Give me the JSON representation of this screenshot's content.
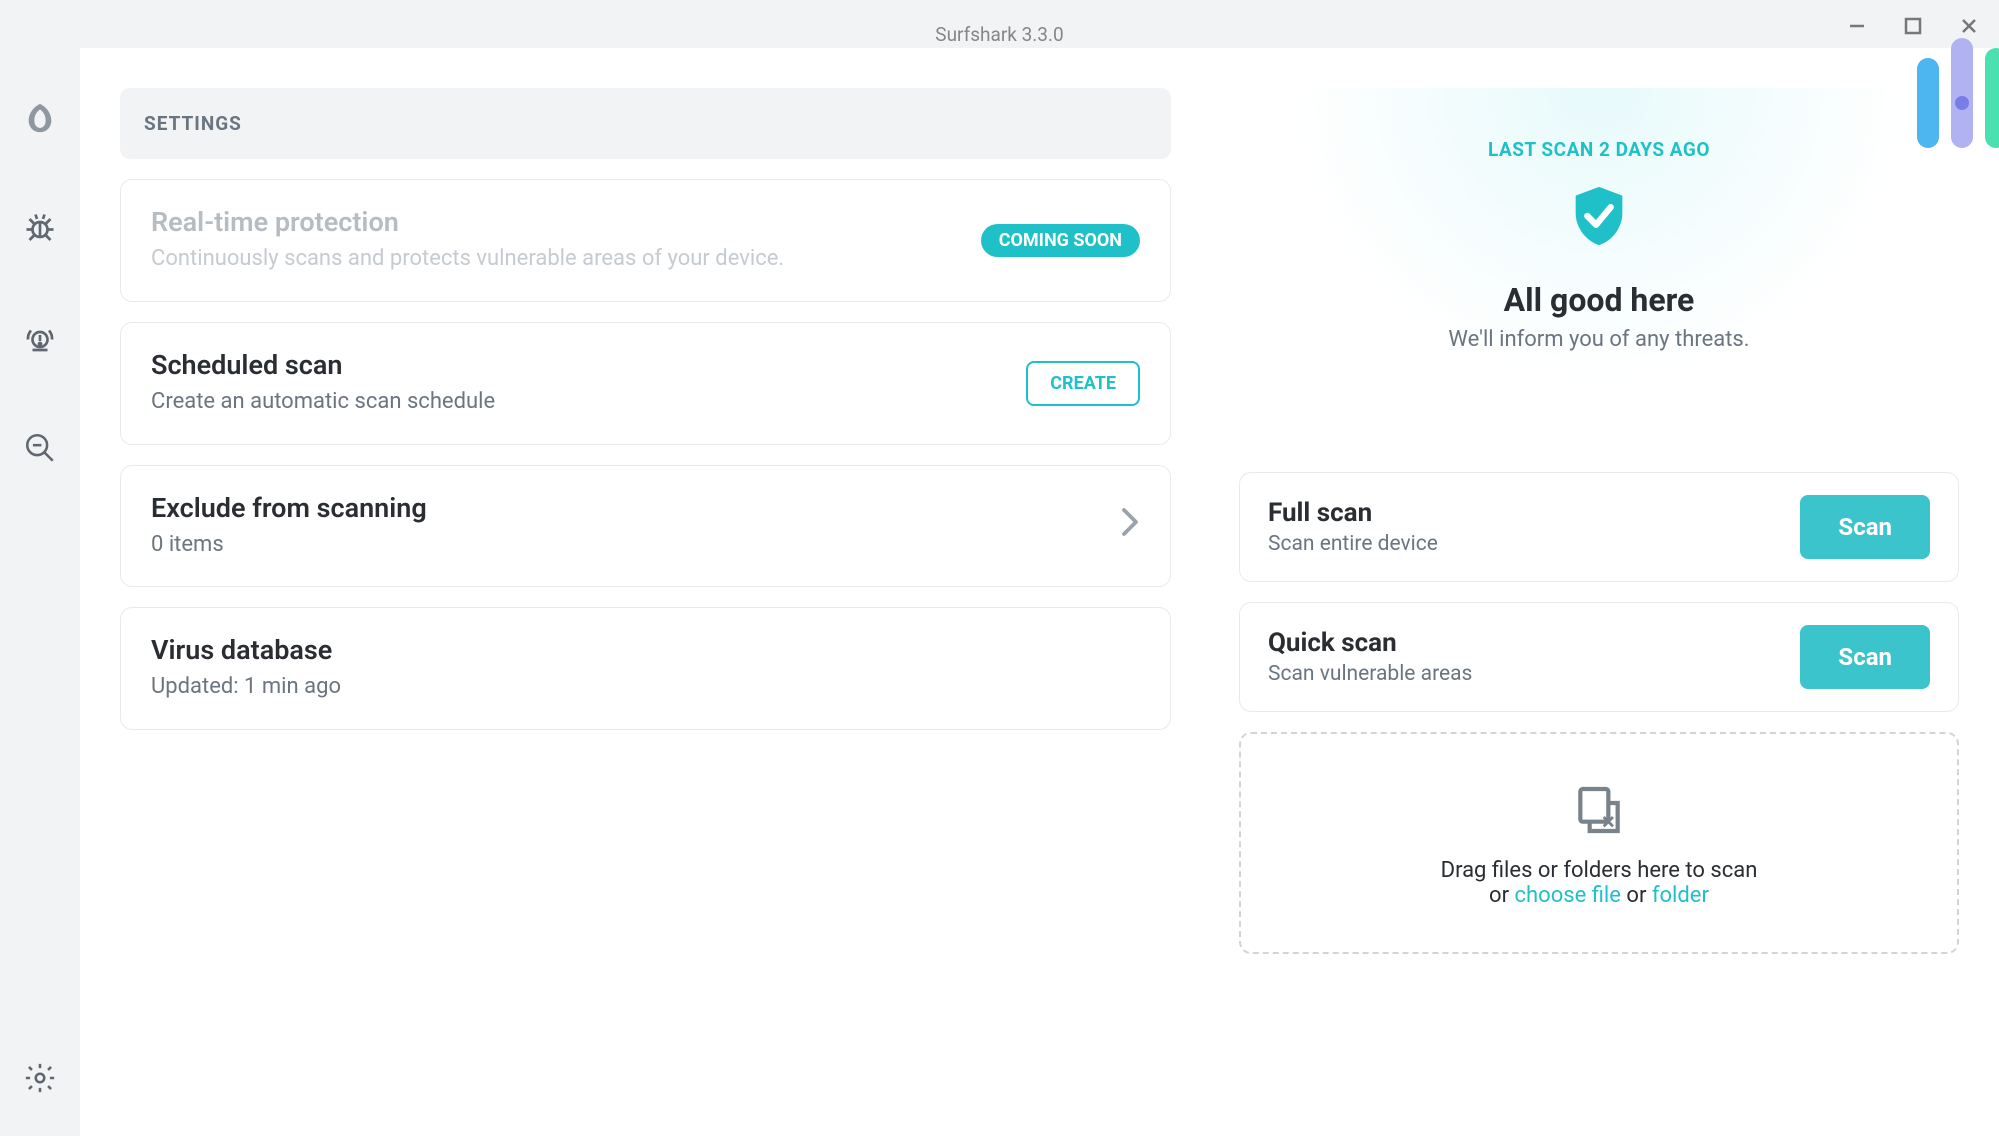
{
  "titlebar": {
    "title": "Surfshark 3.3.0"
  },
  "settings": {
    "header": "SETTINGS",
    "items": [
      {
        "title": "Real-time protection",
        "desc": "Continuously scans and protects vulnerable areas of your device.",
        "badge": "COMING SOON"
      },
      {
        "title": "Scheduled scan",
        "desc": "Create an automatic scan schedule",
        "action": "CREATE"
      },
      {
        "title": "Exclude from scanning",
        "desc": "0 items"
      },
      {
        "title": "Virus database",
        "desc": "Updated: 1 min ago"
      }
    ]
  },
  "status": {
    "last_scan": "LAST SCAN 2 DAYS AGO",
    "title": "All good here",
    "sub": "We'll inform you of any threats."
  },
  "scans": {
    "full": {
      "title": "Full scan",
      "sub": "Scan entire device",
      "btn": "Scan"
    },
    "quick": {
      "title": "Quick scan",
      "sub": "Scan vulnerable areas",
      "btn": "Scan"
    }
  },
  "drop": {
    "line1": "Drag files or folders here to scan",
    "or1": "or ",
    "choose_file": "choose file",
    "or2": " or ",
    "folder": "folder"
  }
}
